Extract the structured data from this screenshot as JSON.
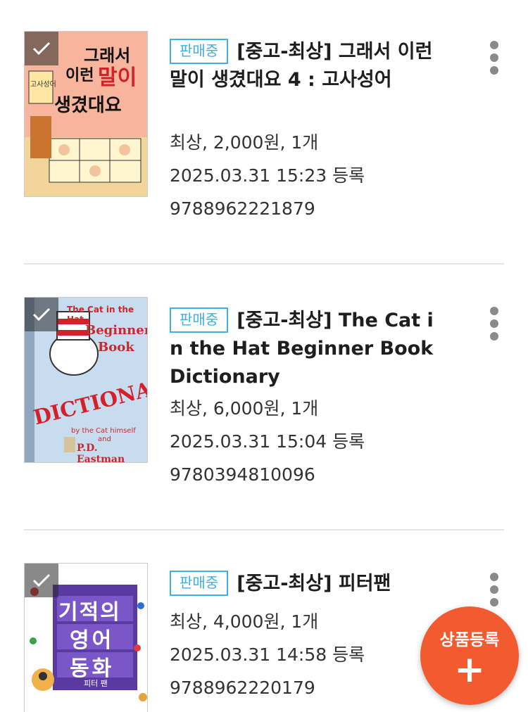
{
  "listings": [
    {
      "status_badge": "판매중",
      "title": "[중고-최상] 그래서 이런 말이 생겼대요 4 : 고사성어",
      "summary": "최상, 2,000원, 1개",
      "registered": "2025.03.31 15:23 등록",
      "isbn": "9788962221879",
      "cover_text": [
        "그래서",
        "이런",
        "말이",
        "생겼대요",
        "고사성어"
      ]
    },
    {
      "status_badge": "판매중",
      "title": "[중고-최상] The Cat in the Hat Beginner Book Dictionary",
      "summary": "최상, 6,000원, 1개",
      "registered": "2025.03.31 15:04 등록",
      "isbn": "9780394810096",
      "cover_text": [
        "The Cat in the Hat",
        "Beginner",
        "Book",
        "DICTIONARY",
        "by the Cat himself",
        "and",
        "P.D. Eastman"
      ]
    },
    {
      "status_badge": "판매중",
      "title": "[중고-최상] 피터팬",
      "summary": "최상, 4,000원, 1개",
      "registered": "2025.03.31 14:58 등록",
      "isbn": "9788962220179",
      "cover_text": [
        "기적의",
        "영어",
        "동화",
        "피터 팬"
      ]
    }
  ],
  "fab": {
    "label": "상품등록",
    "icon": "plus-icon"
  },
  "colors": {
    "badge": "#3fb0e0",
    "fab": "#f25a2f",
    "divider": "#e6e6e6"
  }
}
